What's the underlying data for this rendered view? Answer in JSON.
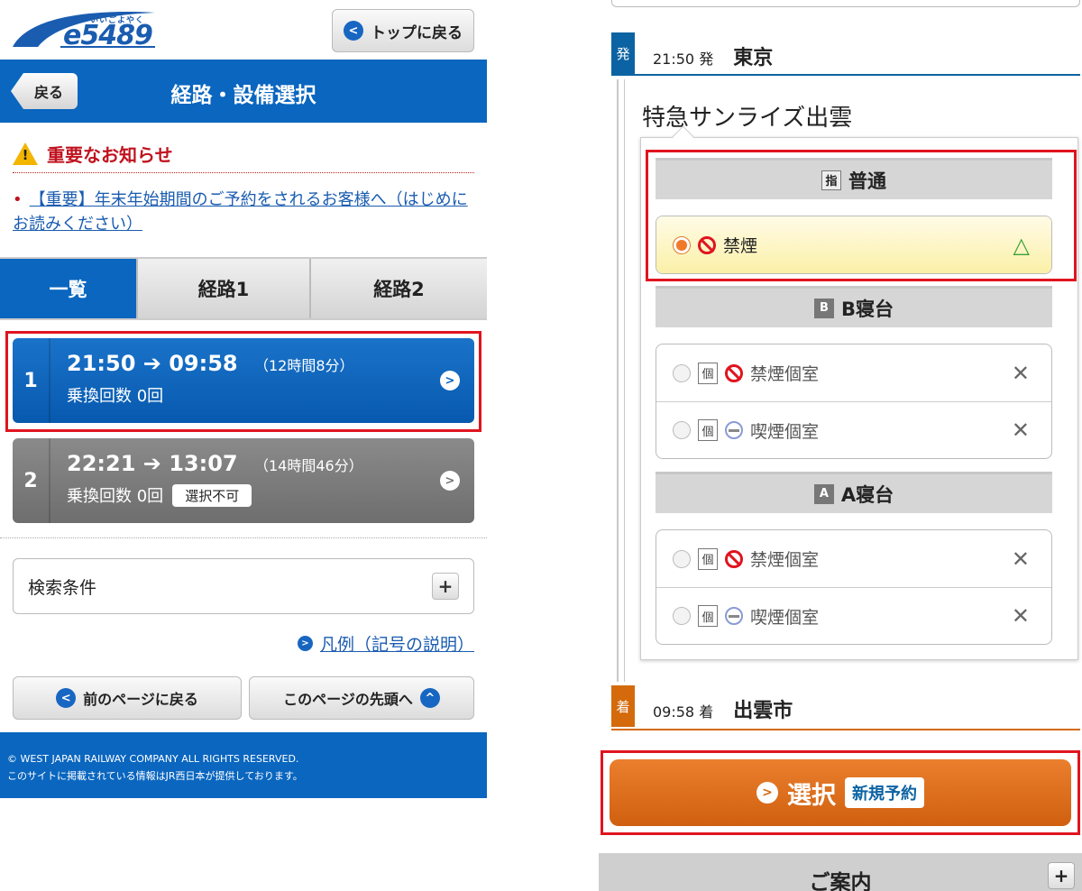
{
  "left": {
    "logo": {
      "text": "e5489",
      "sub": "いいごよやく"
    },
    "top_button": {
      "label": "トップに戻る"
    },
    "header": {
      "back_label": "戻る",
      "title": "経路・設備選択"
    },
    "notice": {
      "title": "重要なお知らせ",
      "link_text": "【重要】年末年始期間のご予約をされるお客様へ（はじめにお読みください）"
    },
    "tabs": [
      {
        "label": "一覧",
        "active": true
      },
      {
        "label": "経路1",
        "active": false
      },
      {
        "label": "経路2",
        "active": false
      }
    ],
    "routes": [
      {
        "num": "1",
        "depart": "21:50",
        "arrive": "09:58",
        "duration": "（12時間8分）",
        "transfers": "乗換回数 0回",
        "badge": ""
      },
      {
        "num": "2",
        "depart": "22:21",
        "arrive": "13:07",
        "duration": "（14時間46分）",
        "transfers": "乗換回数 0回",
        "badge": "選択不可"
      }
    ],
    "search_conditions": {
      "label": "検索条件"
    },
    "legend_link": "凡例（記号の説明）",
    "nav": {
      "prev_page": "前のページに戻る",
      "page_top": "このページの先頭へ"
    },
    "footer": {
      "line1": "© WEST JAPAN RAILWAY COMPANY ALL RIGHTS RESERVED.",
      "line2": "このサイトに掲載されている情報はJR西日本が提供しております。"
    }
  },
  "right": {
    "departure": {
      "label": "発",
      "time": "21:50 発",
      "station": "東京"
    },
    "train_name": "特急サンライズ出雲",
    "classes": [
      {
        "box": "指",
        "name": "普通",
        "options": [
          {
            "type_box": "",
            "smoking": false,
            "name": "禁煙",
            "availability": "△",
            "selected": true
          }
        ]
      },
      {
        "box": "B",
        "name": "B寝台",
        "options": [
          {
            "type_box": "個",
            "smoking": false,
            "name": "禁煙個室",
            "availability": "✕",
            "selected": false
          },
          {
            "type_box": "個",
            "smoking": true,
            "name": "喫煙個室",
            "availability": "✕",
            "selected": false
          }
        ]
      },
      {
        "box": "A",
        "name": "A寝台",
        "options": [
          {
            "type_box": "個",
            "smoking": false,
            "name": "禁煙個室",
            "availability": "✕",
            "selected": false
          },
          {
            "type_box": "個",
            "smoking": true,
            "name": "喫煙個室",
            "availability": "✕",
            "selected": false
          }
        ]
      }
    ],
    "arrival": {
      "label": "着",
      "time": "09:58 着",
      "station": "出雲市"
    },
    "select_button": {
      "label": "選択",
      "badge": "新規予約"
    },
    "guide": {
      "label": "ご案内"
    }
  },
  "colors": {
    "brand_blue": "#0a66bf",
    "highlight_red": "#e0141f",
    "action_orange": "#d46a0c"
  }
}
